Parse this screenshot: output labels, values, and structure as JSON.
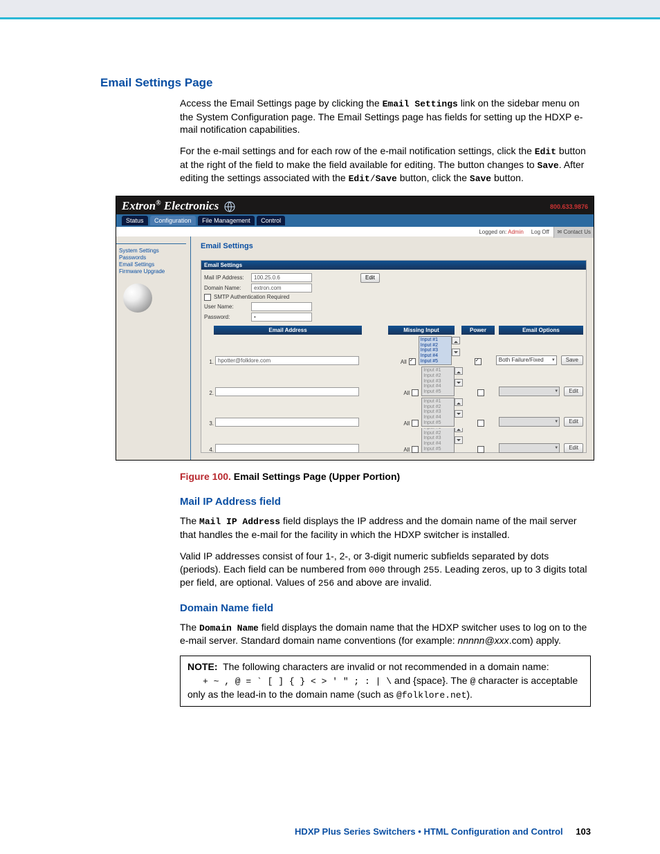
{
  "h1": "Email Settings Page",
  "p1a": "Access the Email Settings page by clicking the ",
  "p1b": "Email Settings",
  "p1c": " link on the sidebar menu on the System Configuration page. The Email Settings page has fields for setting up the HDXP e-mail notification capabilities.",
  "p2a": "For the e-mail settings and for each row of the e-mail notification settings, click the ",
  "p2b": "Edit",
  "p2c": " button at the right of the field to make the field available for editing. The button changes to ",
  "p2d": "Save",
  "p2e": ". After editing the settings associated with the ",
  "p2f": "Edit",
  "p2g": "/",
  "p2h": "Save",
  "p2i": " button, click the ",
  "p2j": "Save",
  "p2k": " button.",
  "figcap_num": "Figure 100.",
  "figcap_title": " Email Settings Page (Upper Portion)",
  "h2a": "Mail IP Address field",
  "p3a": "The ",
  "p3b": "Mail IP Address",
  "p3c": " field displays the IP address and the domain name of the mail server that handles the e-mail for the facility in which the HDXP switcher is installed.",
  "p4a": "Valid IP addresses consist of four 1-, 2-, or 3-digit numeric subfields separated by dots (periods). Each field can be numbered from ",
  "p4b": "000",
  "p4c": " through ",
  "p4d": "255",
  "p4e": ". Leading zeros, up to 3 digits total per field, are optional. Values of ",
  "p4f": "256",
  "p4g": " and above are invalid.",
  "h2b": "Domain Name field",
  "p5a": "The ",
  "p5b": "Domain Name",
  "p5c": " field displays the domain name that the HDXP switcher uses to log on to the e-mail server. Standard domain name conventions (for example: ",
  "p5d": "nnnnn@xxx",
  "p5e": ".com) apply.",
  "note_label": "NOTE:",
  "note_body1": "The following characters are invalid or not recommended in a domain name: ",
  "note_chars": "+ ~ , @ = ` [ ] { } < > ' \" ; : | \\",
  "note_body2": " and {space}. The ",
  "note_at": "@",
  "note_body3": " character is acceptable only as the lead-in to the domain name (such as ",
  "note_ex": "@folklore.net",
  "note_body4": ").",
  "footer_text": "HDXP Plus Series Switchers • HTML Configuration and Control",
  "footer_page": "103",
  "shot": {
    "brand": "Extron",
    "brand2": "Electronics",
    "tabs": [
      "Status",
      "Configuration",
      "File Management",
      "Control"
    ],
    "phone": "800.633.9876",
    "logged": "Logged on: ",
    "logged_user": "Admin",
    "logoff": "Log Off",
    "contact": "Contact Us",
    "side": [
      "System Settings",
      "Passwords",
      "Email Settings",
      "Firmware Upgrade"
    ],
    "es_title": "Email Settings",
    "panel_hdr": "Email Settings",
    "mailip_l": "Mail IP Address:",
    "mailip_v": "100.25.0.6",
    "domain_l": "Domain Name:",
    "domain_v": "extron.com",
    "smtp_l": "SMTP Authentication Required",
    "user_l": "User Name:",
    "pass_l": "Password:",
    "pass_v": "•",
    "edit_btn": "Edit",
    "save_btn": "Save",
    "col_email": "Email Address",
    "col_missing": "Missing Input",
    "col_power": "Power",
    "col_opts": "Email Options",
    "inputs": [
      "Input #1",
      "Input #2",
      "Input #3",
      "Input #4",
      "Input #5"
    ],
    "all": "All",
    "rows": [
      {
        "n": "1.",
        "email": "hpotter@folklore.com",
        "active": true,
        "opt": "Both Failure/Fixed",
        "btn": "Save"
      },
      {
        "n": "2.",
        "email": "",
        "active": false,
        "opt": "",
        "btn": "Edit"
      },
      {
        "n": "3.",
        "email": "",
        "active": false,
        "opt": "",
        "btn": "Edit"
      },
      {
        "n": "4.",
        "email": "",
        "active": false,
        "opt": "",
        "btn": "Edit"
      }
    ]
  }
}
